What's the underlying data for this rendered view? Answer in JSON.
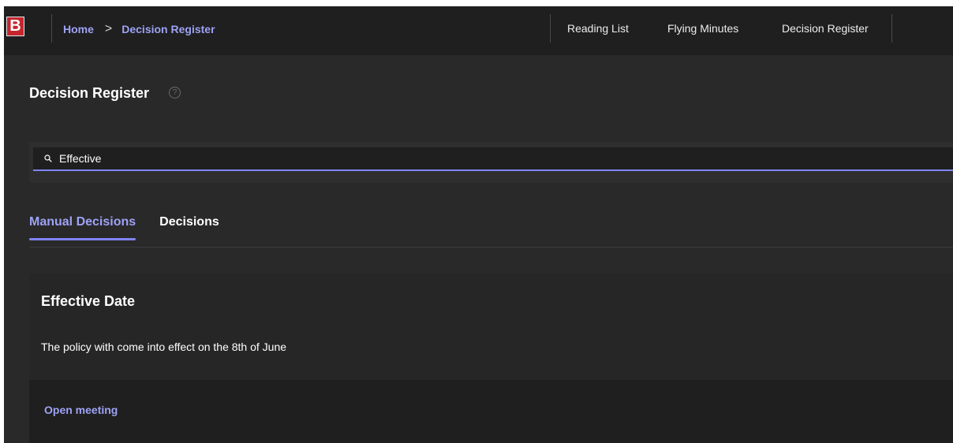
{
  "app": {
    "logo_letter": "B",
    "logo_color": "#c4262e",
    "accent_color": "#7f85f5"
  },
  "breadcrumb": {
    "home": "Home",
    "separator": ">",
    "current": "Decision Register"
  },
  "nav": {
    "items": [
      "Reading List",
      "Flying Minutes",
      "Decision Register"
    ]
  },
  "page": {
    "title": "Decision Register",
    "help_icon": "?"
  },
  "search": {
    "icon": "search-icon",
    "value": "Effective"
  },
  "tabs": [
    {
      "label": "Manual Decisions",
      "active": true
    },
    {
      "label": "Decisions",
      "active": false
    }
  ],
  "result": {
    "title": "Effective Date",
    "description": "The policy with come into effect on the 8th of June",
    "action_label": "Open meeting"
  }
}
